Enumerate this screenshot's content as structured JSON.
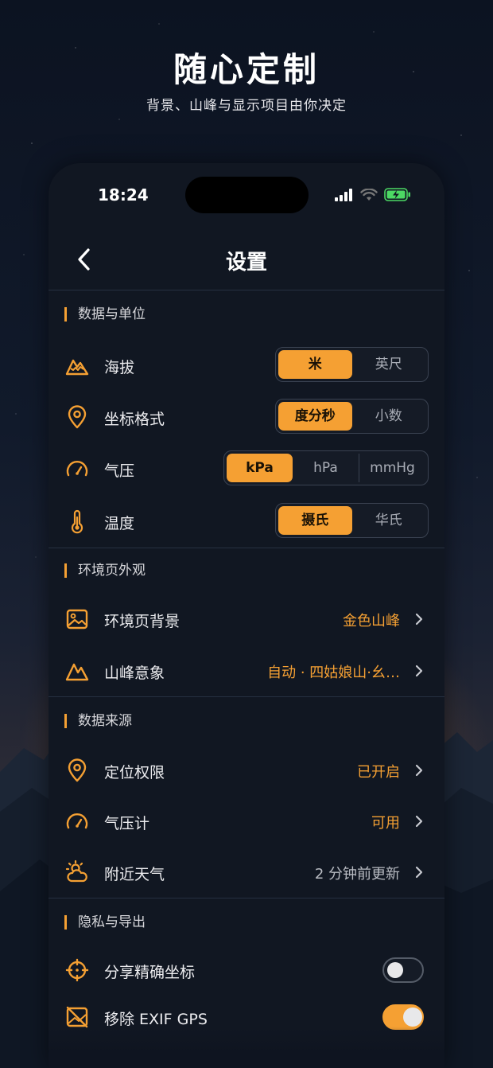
{
  "hero": {
    "title": "随心定制",
    "subtitle": "背景、山峰与显示项目由你决定"
  },
  "status_bar": {
    "time": "18:24",
    "icons": [
      "signal-icon",
      "wifi-icon",
      "battery-charging-icon"
    ]
  },
  "nav": {
    "title": "设置",
    "back_icon": "chevron-left-icon"
  },
  "colors": {
    "accent": "#f5a033",
    "background": "#111722",
    "battery": "#4cd964"
  },
  "sections": {
    "units": {
      "header": "数据与单位",
      "rows": [
        {
          "label": "海拔",
          "icon": "mountain-icon",
          "options": [
            "米",
            "英尺"
          ],
          "selected": "米"
        },
        {
          "label": "坐标格式",
          "icon": "location-pin-icon",
          "options": [
            "度分秒",
            "小数"
          ],
          "selected": "度分秒"
        },
        {
          "label": "气压",
          "icon": "gauge-icon",
          "options": [
            "kPa",
            "hPa",
            "mmHg"
          ],
          "selected": "kPa"
        },
        {
          "label": "温度",
          "icon": "thermometer-icon",
          "options": [
            "摄氏",
            "华氏"
          ],
          "selected": "摄氏"
        }
      ]
    },
    "appearance": {
      "header": "环境页外观",
      "rows": [
        {
          "label": "环境页背景",
          "icon": "image-icon",
          "value": "金色山峰"
        },
        {
          "label": "山峰意象",
          "icon": "mountain-outline-icon",
          "value": "自动 · 四姑娘山·幺…"
        }
      ]
    },
    "sources": {
      "header": "数据来源",
      "rows": [
        {
          "label": "定位权限",
          "icon": "location-pin-icon",
          "value": "已开启"
        },
        {
          "label": "气压计",
          "icon": "gauge-icon",
          "value": "可用"
        },
        {
          "label": "附近天气",
          "icon": "sun-cloud-icon",
          "value": "2 分钟前更新"
        }
      ]
    },
    "privacy": {
      "header": "隐私与导出",
      "rows": [
        {
          "label": "分享精确坐标",
          "icon": "crosshair-icon",
          "toggle": false
        },
        {
          "label": "移除 EXIF GPS",
          "icon": "no-location-image-icon",
          "toggle": true
        }
      ]
    }
  }
}
